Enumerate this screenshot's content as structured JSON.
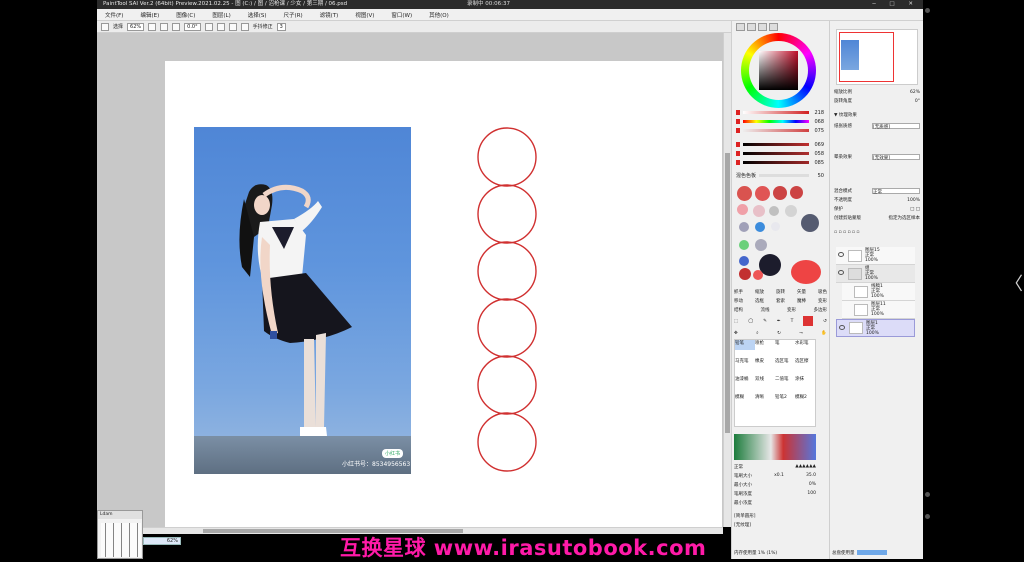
{
  "window": {
    "title": "PaintTool SAI Ver.2 (64bit) Preview.2021.02.25 - 图 (C:) / 图 / 沼枪课 / 少女 / 第三期 / 06.psd",
    "recording": "录制中 00:06:37",
    "controls": "─ □ ✕"
  },
  "menu": [
    "文件(F)",
    "编辑(E)",
    "图像(C)",
    "图层(L)",
    "选择(S)",
    "尺子(R)",
    "滤镜(T)",
    "视图(V)",
    "窗口(W)",
    "其他(O)"
  ],
  "toolbar": {
    "mode_label": "选择",
    "zoom": "62%",
    "angle": "0.0°",
    "stabilizer_label": "手抖修正",
    "stabilizer_value": "3"
  },
  "color_sliders": [
    {
      "value": "218",
      "color": "#d02020"
    },
    {
      "value": "068",
      "color": "#a0c020"
    },
    {
      "value": "075",
      "color": "#d04040"
    },
    {
      "value": "069",
      "color": "#c03030"
    },
    {
      "value": "058",
      "color": "#b03030"
    },
    {
      "value": "085",
      "color": "#a02828"
    }
  ],
  "palette_label": "混色色板",
  "palette_value": "50",
  "swatch_colors": [
    "#d9534f",
    "#e05555",
    "#cc4444",
    "#c44",
    "#f0a0a8",
    "#e8c0c8",
    "#c0c0c0",
    "#d4d4d4",
    "#a0a0b8",
    "#3c8cdc",
    "#555b70",
    "#e8e8ee",
    "#6ad07a",
    "#aab",
    "#4466cc",
    "#c23030",
    "#1c1c2c",
    "#e44",
    "#e55"
  ],
  "tools": [
    [
      "抓手",
      "缩放",
      "旋转",
      "矢量",
      "吸色"
    ],
    [
      "移动",
      "选框",
      "套索",
      "魔棒",
      "变形"
    ],
    [
      "结构",
      "流线",
      "变形",
      "多边形"
    ]
  ],
  "brushes": [
    [
      "铅笔",
      "喷枪",
      "笔",
      "水彩笔"
    ],
    [
      "马克笔",
      "橡皮",
      "选区笔",
      "选区擦"
    ],
    [
      "油漆桶",
      "双线",
      "二值笔",
      "涂抹"
    ],
    [
      "模糊",
      "清晰",
      "铅笔2",
      "模糊2"
    ]
  ],
  "brush_props": {
    "mode": "正常",
    "size_label": "笔刷大小",
    "size_mult": "x0.1",
    "size_value": "35.0",
    "min_size_label": "最小大小",
    "min_size_value": "0%",
    "density_label": "笔刷浓度",
    "density_value": "100",
    "min_density_label": "最小浓度",
    "shape_label": "[简单圆形]",
    "texture_label": "[无纹理]",
    "footer": "内存使用量 1% (1%)"
  },
  "layer_props": {
    "zoom_label": "缩放比例",
    "zoom_value": "62%",
    "angle_label": "旋转角度",
    "angle_value": "0°",
    "effects_label": "▼ 纹理效果",
    "texture_label": "纸张质感",
    "texture_value": "[无质感]",
    "effect_label": "晕染效果",
    "effect_value": "[无效果]",
    "blend_label": "混合模式",
    "blend_value": "正常",
    "opacity_label": "不透明度",
    "opacity_value": "100%",
    "protect_label": "保护",
    "clip_label": "创建剪贴蒙版",
    "select_label": "指定为选区样本"
  },
  "layers": [
    {
      "name": "图层15",
      "mode": "正常",
      "opacity": "100%",
      "type": "layer",
      "selected": false
    },
    {
      "name": "组",
      "mode": "正常",
      "opacity": "100%",
      "type": "folder",
      "selected": false
    },
    {
      "name": "线稿1",
      "mode": "正常",
      "opacity": "100%",
      "type": "layer",
      "selected": false
    },
    {
      "name": "图层11",
      "mode": "正常",
      "opacity": "100%",
      "type": "layer",
      "selected": false
    },
    {
      "name": "图层1",
      "mode": "正常",
      "opacity": "100%",
      "type": "layer",
      "selected": true
    }
  ],
  "layer_footer": "总盘使用量",
  "photo": {
    "caption": "小红书号：8534956563",
    "badge": "小红书"
  },
  "mininav": {
    "title": "Ldam",
    "zoom": "62%"
  },
  "watermark": "互换星球 www.irasutobook.com",
  "nav_arrow": "〈"
}
